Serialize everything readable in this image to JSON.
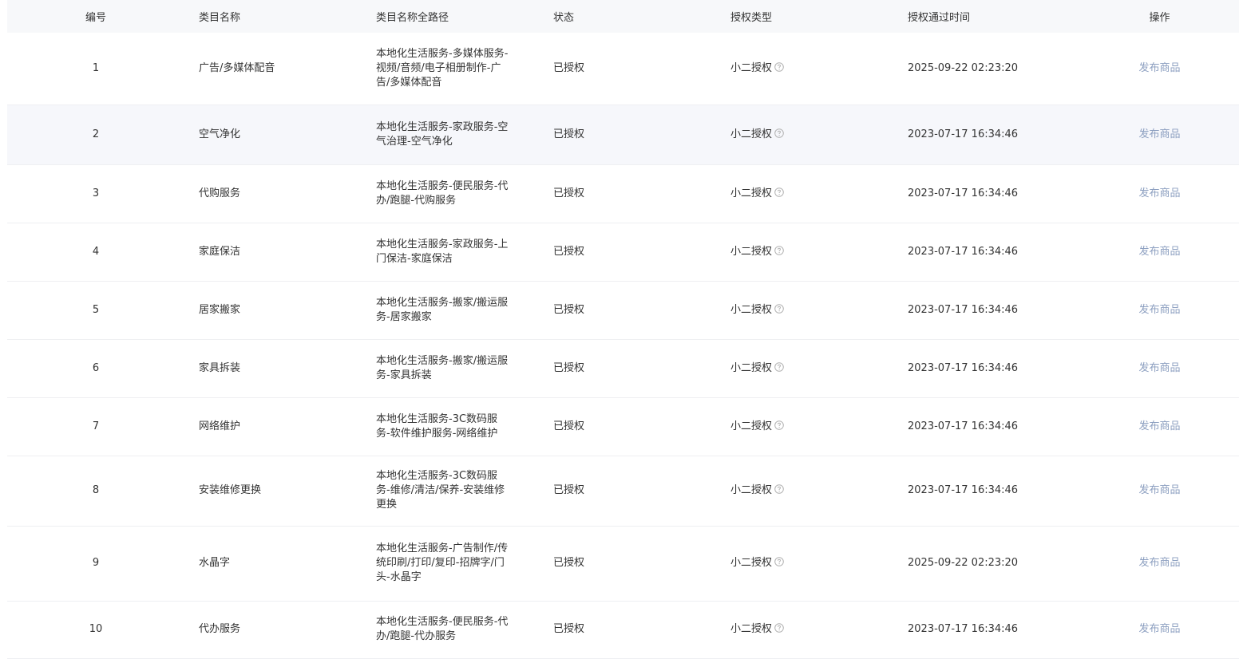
{
  "table": {
    "headers": {
      "id": "编号",
      "name": "类目名称",
      "path": "类目名称全路径",
      "status": "状态",
      "auth_type": "授权类型",
      "auth_time": "授权通过时间",
      "action": "操作"
    },
    "rows": [
      {
        "id": "1",
        "name": "广告/多媒体配音",
        "path": "本地化生活服务-多媒体服务-视频/音频/电子相册制作-广告/多媒体配音",
        "status": "已授权",
        "auth_type": "小二授权",
        "auth_time": "2025-09-22 02:23:20",
        "action": "发布商品"
      },
      {
        "id": "2",
        "name": "空气净化",
        "path": "本地化生活服务-家政服务-空气治理-空气净化",
        "status": "已授权",
        "auth_type": "小二授权",
        "auth_time": "2023-07-17 16:34:46",
        "action": "发布商品"
      },
      {
        "id": "3",
        "name": "代购服务",
        "path": "本地化生活服务-便民服务-代办/跑腿-代购服务",
        "status": "已授权",
        "auth_type": "小二授权",
        "auth_time": "2023-07-17 16:34:46",
        "action": "发布商品"
      },
      {
        "id": "4",
        "name": "家庭保洁",
        "path": "本地化生活服务-家政服务-上门保洁-家庭保洁",
        "status": "已授权",
        "auth_type": "小二授权",
        "auth_time": "2023-07-17 16:34:46",
        "action": "发布商品"
      },
      {
        "id": "5",
        "name": "居家搬家",
        "path": "本地化生活服务-搬家/搬运服务-居家搬家",
        "status": "已授权",
        "auth_type": "小二授权",
        "auth_time": "2023-07-17 16:34:46",
        "action": "发布商品"
      },
      {
        "id": "6",
        "name": "家具拆装",
        "path": "本地化生活服务-搬家/搬运服务-家具拆装",
        "status": "已授权",
        "auth_type": "小二授权",
        "auth_time": "2023-07-17 16:34:46",
        "action": "发布商品"
      },
      {
        "id": "7",
        "name": "网络维护",
        "path": "本地化生活服务-3C数码服务-软件维护服务-网络维护",
        "status": "已授权",
        "auth_type": "小二授权",
        "auth_time": "2023-07-17 16:34:46",
        "action": "发布商品"
      },
      {
        "id": "8",
        "name": "安装维修更换",
        "path": "本地化生活服务-3C数码服务-维修/清洁/保养-安装维修更换",
        "status": "已授权",
        "auth_type": "小二授权",
        "auth_time": "2023-07-17 16:34:46",
        "action": "发布商品"
      },
      {
        "id": "9",
        "name": "水晶字",
        "path": "本地化生活服务-广告制作/传统印刷/打印/复印-招牌字/门头-水晶字",
        "status": "已授权",
        "auth_type": "小二授权",
        "auth_time": "2025-09-22 02:23:20",
        "action": "发布商品"
      },
      {
        "id": "10",
        "name": "代办服务",
        "path": "本地化生活服务-便民服务-代办/跑腿-代办服务",
        "status": "已授权",
        "auth_type": "小二授权",
        "auth_time": "2023-07-17 16:34:46",
        "action": "发布商品"
      }
    ]
  },
  "icons": {
    "help": "question-circle-icon"
  },
  "colors": {
    "header_bg": "#f7f8fa",
    "row_stripe": "#f6f7fb",
    "link": "#8c9fc0",
    "text": "#333333"
  }
}
